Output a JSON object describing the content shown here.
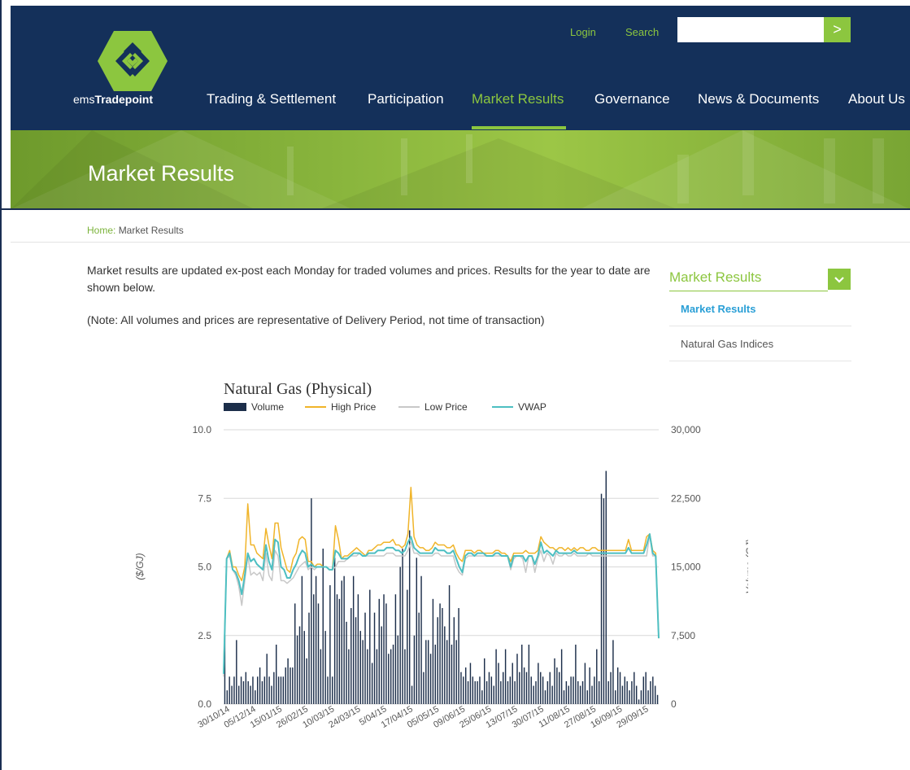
{
  "header": {
    "brand_prefix": "ems",
    "brand_bold": "Tradepoint",
    "login": "Login",
    "search_link": "Search",
    "search_placeholder": "",
    "search_button": ">",
    "nav": [
      "Trading & Settlement",
      "Participation",
      "Market Results",
      "Governance",
      "News & Documents",
      "About Us"
    ],
    "active_nav": "Market Results"
  },
  "banner": {
    "title": "Market Results"
  },
  "breadcrumb": {
    "home": "Home:",
    "current": "Market Results"
  },
  "content": {
    "intro": "Market results are updated ex-post each Monday for traded volumes and prices. Results for the year to date are shown below.",
    "note": "(Note: All volumes and prices are representative of Delivery Period, not time of transaction)"
  },
  "sidebar": {
    "title": "Market Results",
    "toggle_icon": "chevron-down-icon",
    "items": [
      {
        "label": "Market Results",
        "active": true
      },
      {
        "label": "Natural Gas Indices",
        "active": false
      }
    ]
  },
  "colors": {
    "navy": "#14305a",
    "green": "#8cc63f",
    "volume": "#1c2e4a",
    "high": "#f0b429",
    "low": "#c8c8c8",
    "vwap": "#4dbfc2"
  },
  "chart_data": {
    "type": "bar+line",
    "title": "Natural Gas (Physical)",
    "legend": [
      "Volume",
      "High Price",
      "Low Price",
      "VWAP"
    ],
    "legend_position": "top",
    "ylabel_left": "($/GJ)",
    "ylabel_right": "Volume (GJ)",
    "y_left_ticks": [
      "10.0",
      "7.5",
      "5.0",
      "2.5",
      "0.0"
    ],
    "y_right_ticks": [
      "30,000",
      "22,500",
      "15,000",
      "7,500",
      "0"
    ],
    "ylim_left": [
      0,
      10
    ],
    "ylim_right": [
      0,
      30000
    ],
    "grid": true,
    "x_tick_labels": [
      "30/10/14",
      "05/12/14",
      "15/01/15",
      "26/02/15",
      "10/03/15",
      "24/03/15",
      "5/04/15",
      "17/04/15",
      "05/05/15",
      "09/06/15",
      "25/06/15",
      "13/07/15",
      "30/07/15",
      "11/08/15",
      "27/08/15",
      "16/09/15",
      "29/09/15"
    ],
    "volume": [
      7500,
      1500,
      3000,
      2000,
      3000,
      7000,
      2000,
      3000,
      2500,
      3500,
      2500,
      2000,
      3000,
      1500,
      3000,
      4000,
      2500,
      3000,
      5500,
      3000,
      2000,
      3500,
      6500,
      3000,
      3000,
      3000,
      4000,
      5000,
      4000,
      4000,
      11000,
      7500,
      8500,
      14000,
      8000,
      5000,
      10000,
      22500,
      12000,
      14000,
      11000,
      6000,
      17000,
      8000,
      3000,
      13000,
      3000,
      16000,
      12000,
      11500,
      13500,
      14000,
      9000,
      6000,
      10500,
      14000,
      9500,
      12000,
      8000,
      7000,
      10000,
      6000,
      12500,
      4500,
      10000,
      6000,
      11500,
      8500,
      12000,
      11000,
      5500,
      6000,
      6500,
      12000,
      7500,
      15000,
      17000,
      6000,
      12500,
      19000,
      2000,
      7500,
      16000,
      10000,
      14000,
      3500,
      7000,
      7000,
      5500,
      11500,
      6500,
      9500,
      11000,
      10500,
      8500,
      7000,
      13000,
      6500,
      9500,
      7000,
      10500,
      3500,
      3000,
      4000,
      2500,
      4500,
      3000,
      2500,
      2500,
      3000,
      1500,
      5000,
      2500,
      3500,
      3000,
      2000,
      6000,
      4500,
      2500,
      3500,
      6000,
      2500,
      3000,
      4500,
      2500,
      5500,
      3500,
      6500,
      4000,
      3500,
      6500,
      3000,
      2000,
      2500,
      4500,
      3500,
      3000,
      1500,
      2500,
      3500,
      2000,
      5000,
      4000,
      3500,
      6000,
      1500,
      2500,
      2000,
      3000,
      3000,
      6500,
      2500,
      2000,
      2500,
      4500,
      1500,
      4000,
      2000,
      3000,
      6000,
      2500,
      23000,
      22500,
      25500,
      2500,
      3500,
      7000,
      1500,
      4000,
      3500,
      2000,
      3000,
      2500,
      1500,
      2500,
      3500,
      2000,
      500,
      1500,
      3000,
      3500,
      1500,
      2500,
      3000,
      2000,
      1000
    ],
    "high_price": [
      1.2,
      5.3,
      5.6,
      5.0,
      5.0,
      4.7,
      4.5,
      5.0,
      7.3,
      5.8,
      5.8,
      5.5,
      5.4,
      5.3,
      6.4,
      5.8,
      5.3,
      6.6,
      6.6,
      5.7,
      5.3,
      4.9,
      4.8,
      5.3,
      5.5,
      6.0,
      6.1,
      6.0,
      5.2,
      5.2,
      5.0,
      5.1,
      5.1,
      5.0,
      5.0,
      4.9,
      4.9,
      6.5,
      6.0,
      5.3,
      5.4,
      5.4,
      5.5,
      5.6,
      5.7,
      5.6,
      5.5,
      5.4,
      5.6,
      5.6,
      5.7,
      5.8,
      5.8,
      5.9,
      5.9,
      5.9,
      6.0,
      5.8,
      5.8,
      5.7,
      5.8,
      6.2,
      7.9,
      6.1,
      5.8,
      5.7,
      5.7,
      5.6,
      5.6,
      5.7,
      5.9,
      5.8,
      5.8,
      5.8,
      5.7,
      5.7,
      5.8,
      5.5,
      5.3,
      5.2,
      5.6,
      5.6,
      5.6,
      5.5,
      5.6,
      5.6,
      5.5,
      5.5,
      5.5,
      5.5,
      5.6,
      5.6,
      5.5,
      5.5,
      5.4,
      5.2,
      5.5,
      5.5,
      5.5,
      5.5,
      5.6,
      5.5,
      5.5,
      5.5,
      5.6,
      6.1,
      5.9,
      5.8,
      5.7,
      5.7,
      5.6,
      5.7,
      5.7,
      5.6,
      5.7,
      5.6,
      5.7,
      5.6,
      5.7,
      5.7,
      5.6,
      5.6,
      5.7,
      5.7,
      5.6,
      5.6,
      5.6,
      5.6,
      5.6,
      5.6,
      5.6,
      5.6,
      5.6,
      5.6,
      6.0,
      5.6,
      5.6,
      5.6,
      5.6,
      5.6,
      6.1,
      6.2,
      5.6,
      5.5,
      2.4
    ],
    "low_price": [
      1.0,
      5.3,
      5.4,
      4.9,
      4.7,
      4.3,
      3.6,
      4.5,
      5.4,
      4.7,
      4.8,
      4.7,
      4.8,
      4.5,
      5.5,
      4.7,
      4.5,
      5.6,
      5.4,
      4.5,
      4.5,
      4.4,
      4.5,
      4.6,
      4.8,
      5.0,
      5.1,
      5.2,
      4.9,
      5.0,
      4.9,
      5.0,
      5.0,
      5.0,
      5.0,
      4.9,
      4.9,
      5.0,
      5.2,
      5.2,
      5.2,
      5.3,
      5.4,
      5.4,
      5.4,
      5.5,
      5.4,
      5.4,
      5.4,
      5.4,
      5.4,
      5.4,
      5.4,
      5.4,
      5.5,
      5.5,
      5.5,
      5.4,
      5.4,
      5.4,
      5.4,
      5.6,
      5.9,
      5.5,
      5.5,
      5.4,
      5.4,
      5.4,
      5.4,
      5.4,
      5.5,
      5.5,
      5.4,
      5.4,
      5.4,
      5.4,
      5.4,
      5.0,
      4.8,
      4.7,
      5.3,
      5.4,
      5.4,
      5.4,
      5.4,
      5.4,
      5.4,
      5.4,
      5.4,
      5.4,
      5.4,
      5.4,
      5.4,
      5.4,
      5.4,
      4.9,
      5.3,
      5.4,
      5.4,
      5.3,
      4.8,
      5.4,
      5.4,
      4.8,
      5.3,
      5.6,
      5.2,
      5.5,
      5.4,
      5.1,
      5.5,
      5.4,
      5.4,
      5.5,
      5.4,
      5.4,
      5.5,
      5.4,
      5.4,
      5.4,
      5.4,
      5.5,
      5.4,
      5.4,
      5.4,
      5.4,
      5.4,
      5.4,
      5.4,
      5.4,
      5.4,
      5.4,
      5.4,
      5.4,
      5.4,
      5.4,
      5.4,
      5.4,
      5.4,
      5.4,
      5.4,
      6.2,
      5.4,
      5.4,
      2.4
    ],
    "vwap": [
      1.1,
      5.3,
      5.5,
      4.9,
      4.8,
      4.5,
      4.0,
      4.7,
      5.5,
      5.2,
      5.3,
      5.1,
      5.0,
      4.9,
      5.8,
      5.2,
      4.9,
      6.0,
      5.9,
      5.0,
      4.9,
      4.6,
      4.6,
      4.9,
      5.1,
      5.4,
      5.6,
      5.5,
      5.0,
      5.1,
      5.0,
      5.0,
      5.0,
      5.0,
      5.0,
      4.9,
      4.9,
      5.6,
      5.5,
      5.3,
      5.3,
      5.3,
      5.4,
      5.5,
      5.5,
      5.5,
      5.4,
      5.4,
      5.5,
      5.5,
      5.5,
      5.6,
      5.6,
      5.6,
      5.7,
      5.7,
      5.7,
      5.6,
      5.6,
      5.5,
      5.6,
      5.9,
      6.1,
      5.7,
      5.6,
      5.5,
      5.5,
      5.5,
      5.5,
      5.5,
      5.7,
      5.6,
      5.6,
      5.6,
      5.5,
      5.5,
      5.6,
      5.3,
      5.0,
      4.8,
      5.4,
      5.5,
      5.5,
      5.4,
      5.5,
      5.5,
      5.5,
      5.4,
      5.4,
      5.4,
      5.5,
      5.5,
      5.4,
      5.4,
      5.4,
      5.0,
      5.4,
      5.4,
      5.4,
      5.4,
      5.2,
      5.4,
      5.4,
      5.1,
      5.4,
      5.9,
      5.5,
      5.6,
      5.5,
      5.4,
      5.6,
      5.5,
      5.5,
      5.5,
      5.5,
      5.5,
      5.6,
      5.5,
      5.5,
      5.5,
      5.5,
      5.5,
      5.5,
      5.5,
      5.5,
      5.5,
      5.5,
      5.5,
      5.5,
      5.5,
      5.5,
      5.5,
      5.5,
      5.5,
      5.7,
      5.5,
      5.5,
      5.5,
      5.5,
      5.5,
      5.8,
      6.2,
      5.5,
      5.4,
      2.4
    ]
  }
}
